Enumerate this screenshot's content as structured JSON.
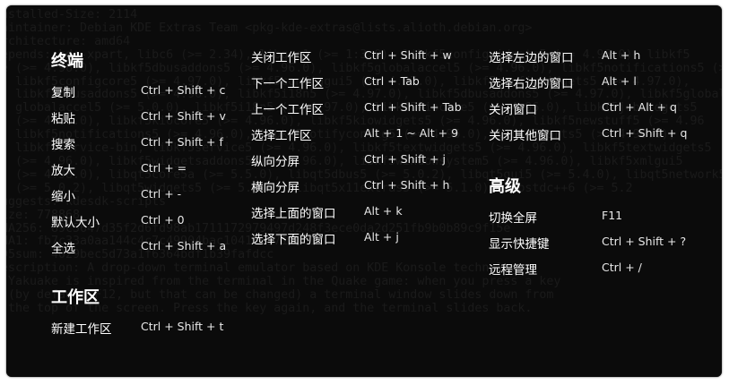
{
  "background_terminal": {
    "lines": [
      "nstalled-Size: 2114",
      "aintainer: Debian KDE Extras Team <pkg-kde-extras@lists.alioth.debian.org>",
      "rchitecture: amd64",
      "epends: kde-xpart, libc6 (>= 2.34), libgcc1 (>= 1:3.0), libkf5configwidgets5 (>= 4.96.0), libkf5",
      "e (>= 4.96.0), libkf5dbusaddons5 (>= 4.96.0), libkf5globalaccel5 (>= 4.96.0), libkf5notifications5 (>=",
      "  libkf5configcore5 (>= 4.97.0), libkf5configgui5 (>= 4.97.0), libkf5configwidgets5 (>= 4.97.0),",
      "  libkf5dbusaddons5 (>= 4.96.0), libkf5i18n5 (>= 4.97.0), libkf5dbusaddons5 (>= 4.97.0), libkf5globala",
      "  globalaccel5 (>= 5.0.0), libkf5i18n5 (>= 4.97.0), libkf5kiocore5 (>= 4.96.0), libkf5jobwidgets5",
      "  (>= 4.96.0), libkf5kiocore5 (>= 4.96.0), libkf5kiowidgets5 (>= 4.96.0), libkf5newstuff5 (>= 4.96",
      "  libkf5notifications5 (>= 4.96.0), libkf5notifyconfig5 (>= 4.96.0), libkf5parts5 (>= 4.96.0),",
      "  libkf5service-bin, libkf5service5 (>= 4.96.0), libkf5textwidgets5 (>= 4.96.0), libkf5textwidgets5",
      "  (>= 4.96.0), libkf5widgetsaddons5 (>= 4.96.0), libkf5windowsystem5 (>= 4.96.0), libkf5xmlgui5",
      "  (>= 4.98.0), libqt5core5a (>= 5.5.0), libqt5dbus5 (>= 5.0.2), libqt5gui5 (>= 5.4.0), libqt5network5",
      "  (>= 5.0.2), libqt5widgets5 (>= 5.4.0), libqt5x11extras5 (>= 5.1.0), libstdc++6 (>= 5.2",
      "uggests: kdesdk-scripts",
      "ize: 778868",
      "HA256: 89c5647d35f2d6fd98ab1711172979497d248f3ece0da2d251fb9b0b89c9f15e",
      "HA1: fb7c33a0aa144c4c7c49904bac104185171a681",
      "D5sum: 4029bec5d73a1f6364bdf1b39fafdcc",
      "escription: A drop-down terminal emulator based on KDE Konsole technology",
      " Yakuake is inspired from the terminal in the Quake game: when you press a key",
      " (by default F12, but that can be changed) a terminal window slides down from",
      " the top of the screen. Press the key again, and the terminal slides back."
    ]
  },
  "shortcut_panel": {
    "col1": {
      "terminal_title": "终端",
      "terminal_items": [
        {
          "label": "复制",
          "keys": "Ctrl + Shift + c"
        },
        {
          "label": "粘贴",
          "keys": "Ctrl + Shift + v"
        },
        {
          "label": "搜索",
          "keys": "Ctrl + Shift + f"
        },
        {
          "label": "放大",
          "keys": "Ctrl + ="
        },
        {
          "label": "缩小",
          "keys": "Ctrl + -"
        },
        {
          "label": "默认大小",
          "keys": "Ctrl + 0"
        },
        {
          "label": "全选",
          "keys": "Ctrl + Shift + a"
        }
      ],
      "workspace_title": "工作区",
      "workspace_items": [
        {
          "label": "新建工作区",
          "keys": "Ctrl + Shift + t"
        }
      ]
    },
    "col2": {
      "items": [
        {
          "label": "关闭工作区",
          "keys": "Ctrl + Shift + w"
        },
        {
          "label": "下一个工作区",
          "keys": "Ctrl + Tab"
        },
        {
          "label": "上一个工作区",
          "keys": "Ctrl + Shift + Tab"
        },
        {
          "label": "选择工作区",
          "keys": "Alt + 1 ~ Alt + 9"
        },
        {
          "label": "纵向分屏",
          "keys": "Ctrl + Shift + j"
        },
        {
          "label": "横向分屏",
          "keys": "Ctrl + Shift + h"
        },
        {
          "label": "选择上面的窗口",
          "keys": "Alt + k"
        },
        {
          "label": "选择下面的窗口",
          "keys": "Alt + j"
        }
      ]
    },
    "col3": {
      "items": [
        {
          "label": "选择左边的窗口",
          "keys": "Alt + h"
        },
        {
          "label": "选择右边的窗口",
          "keys": "Alt + l"
        },
        {
          "label": "关闭窗口",
          "keys": "Ctrl + Alt + q"
        },
        {
          "label": "关闭其他窗口",
          "keys": "Ctrl + Shift + q"
        }
      ],
      "advanced_title": "高级",
      "advanced_items": [
        {
          "label": "切换全屏",
          "keys": "F11"
        },
        {
          "label": "显示快捷键",
          "keys": "Ctrl + Shift + ?"
        },
        {
          "label": "远程管理",
          "keys": "Ctrl + /"
        }
      ]
    }
  }
}
